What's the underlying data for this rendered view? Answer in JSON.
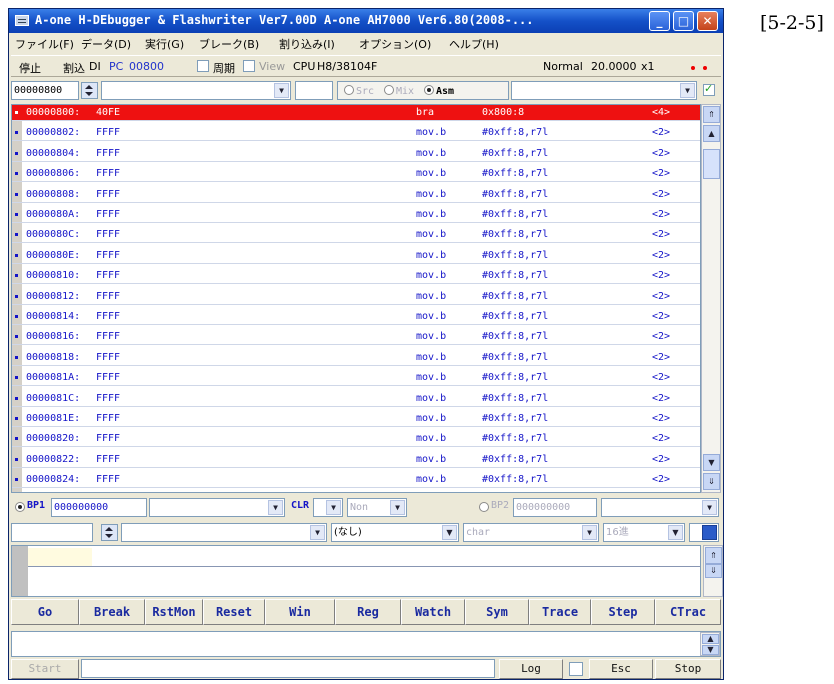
{
  "figure_label": "[5-2-5]",
  "window": {
    "title": "A-one H-DEbugger & Flashwriter Ver7.00D A-one AH7000 Ver6.80(2008-...",
    "minimize": "_",
    "maximize": "□",
    "close": "✕"
  },
  "menu": [
    "ファイル(F)",
    "データ(D)",
    "実行(G)",
    "ブレーク(B)",
    "割り込み(I)",
    "オプション(O)",
    "ヘルプ(H)"
  ],
  "status": {
    "state": "停止",
    "interrupt_label": "割込",
    "interrupt_value": "DI",
    "pc_label": "PC",
    "pc_value": "00800",
    "period_label": "周期",
    "view_label": "View",
    "cpu_label": "CPU",
    "cpu_value": "H8/38104F",
    "mode": "Normal",
    "clock": "20.0000",
    "multiplier": "x1"
  },
  "code_toolbar": {
    "address": "00000800",
    "src_label": "Src",
    "mix_label": "Mix",
    "asm_label": "Asm",
    "selected_mode": "Asm"
  },
  "disasm": [
    {
      "addr": "00000800:",
      "code": "40FE",
      "op": "bra",
      "operand": "0x800:8",
      "cyc": "<4>"
    },
    {
      "addr": "00000802:",
      "code": "FFFF",
      "op": "mov.b",
      "operand": "#0xff:8,r7l",
      "cyc": "<2>"
    },
    {
      "addr": "00000804:",
      "code": "FFFF",
      "op": "mov.b",
      "operand": "#0xff:8,r7l",
      "cyc": "<2>"
    },
    {
      "addr": "00000806:",
      "code": "FFFF",
      "op": "mov.b",
      "operand": "#0xff:8,r7l",
      "cyc": "<2>"
    },
    {
      "addr": "00000808:",
      "code": "FFFF",
      "op": "mov.b",
      "operand": "#0xff:8,r7l",
      "cyc": "<2>"
    },
    {
      "addr": "0000080A:",
      "code": "FFFF",
      "op": "mov.b",
      "operand": "#0xff:8,r7l",
      "cyc": "<2>"
    },
    {
      "addr": "0000080C:",
      "code": "FFFF",
      "op": "mov.b",
      "operand": "#0xff:8,r7l",
      "cyc": "<2>"
    },
    {
      "addr": "0000080E:",
      "code": "FFFF",
      "op": "mov.b",
      "operand": "#0xff:8,r7l",
      "cyc": "<2>"
    },
    {
      "addr": "00000810:",
      "code": "FFFF",
      "op": "mov.b",
      "operand": "#0xff:8,r7l",
      "cyc": "<2>"
    },
    {
      "addr": "00000812:",
      "code": "FFFF",
      "op": "mov.b",
      "operand": "#0xff:8,r7l",
      "cyc": "<2>"
    },
    {
      "addr": "00000814:",
      "code": "FFFF",
      "op": "mov.b",
      "operand": "#0xff:8,r7l",
      "cyc": "<2>"
    },
    {
      "addr": "00000816:",
      "code": "FFFF",
      "op": "mov.b",
      "operand": "#0xff:8,r7l",
      "cyc": "<2>"
    },
    {
      "addr": "00000818:",
      "code": "FFFF",
      "op": "mov.b",
      "operand": "#0xff:8,r7l",
      "cyc": "<2>"
    },
    {
      "addr": "0000081A:",
      "code": "FFFF",
      "op": "mov.b",
      "operand": "#0xff:8,r7l",
      "cyc": "<2>"
    },
    {
      "addr": "0000081C:",
      "code": "FFFF",
      "op": "mov.b",
      "operand": "#0xff:8,r7l",
      "cyc": "<2>"
    },
    {
      "addr": "0000081E:",
      "code": "FFFF",
      "op": "mov.b",
      "operand": "#0xff:8,r7l",
      "cyc": "<2>"
    },
    {
      "addr": "00000820:",
      "code": "FFFF",
      "op": "mov.b",
      "operand": "#0xff:8,r7l",
      "cyc": "<2>"
    },
    {
      "addr": "00000822:",
      "code": "FFFF",
      "op": "mov.b",
      "operand": "#0xff:8,r7l",
      "cyc": "<2>"
    },
    {
      "addr": "00000824:",
      "code": "FFFF",
      "op": "mov.b",
      "operand": "#0xff:8,r7l",
      "cyc": "<2>"
    }
  ],
  "breakpoints": {
    "bp1_label": "BP1",
    "bp1_addr": "000000000",
    "clr_label": "CLR",
    "non_label": "Non",
    "bp2_label": "BP2",
    "bp2_addr": "000000000"
  },
  "watch_bar": {
    "symbol_value": "(なし)",
    "type_value": "char",
    "radix_value": "16進"
  },
  "buttons": [
    "Go",
    "Break",
    "RstMon",
    "Reset",
    "Win",
    "Reg",
    "Watch",
    "Sym",
    "Trace",
    "Step",
    "CTrac"
  ],
  "bottom": {
    "start": "Start",
    "log": "Log",
    "esc": "Esc",
    "stop": "Stop"
  },
  "colors": {
    "current_line_bg": "#ee1111",
    "code_text": "#1414c8",
    "title_bar": "#1451c8"
  }
}
